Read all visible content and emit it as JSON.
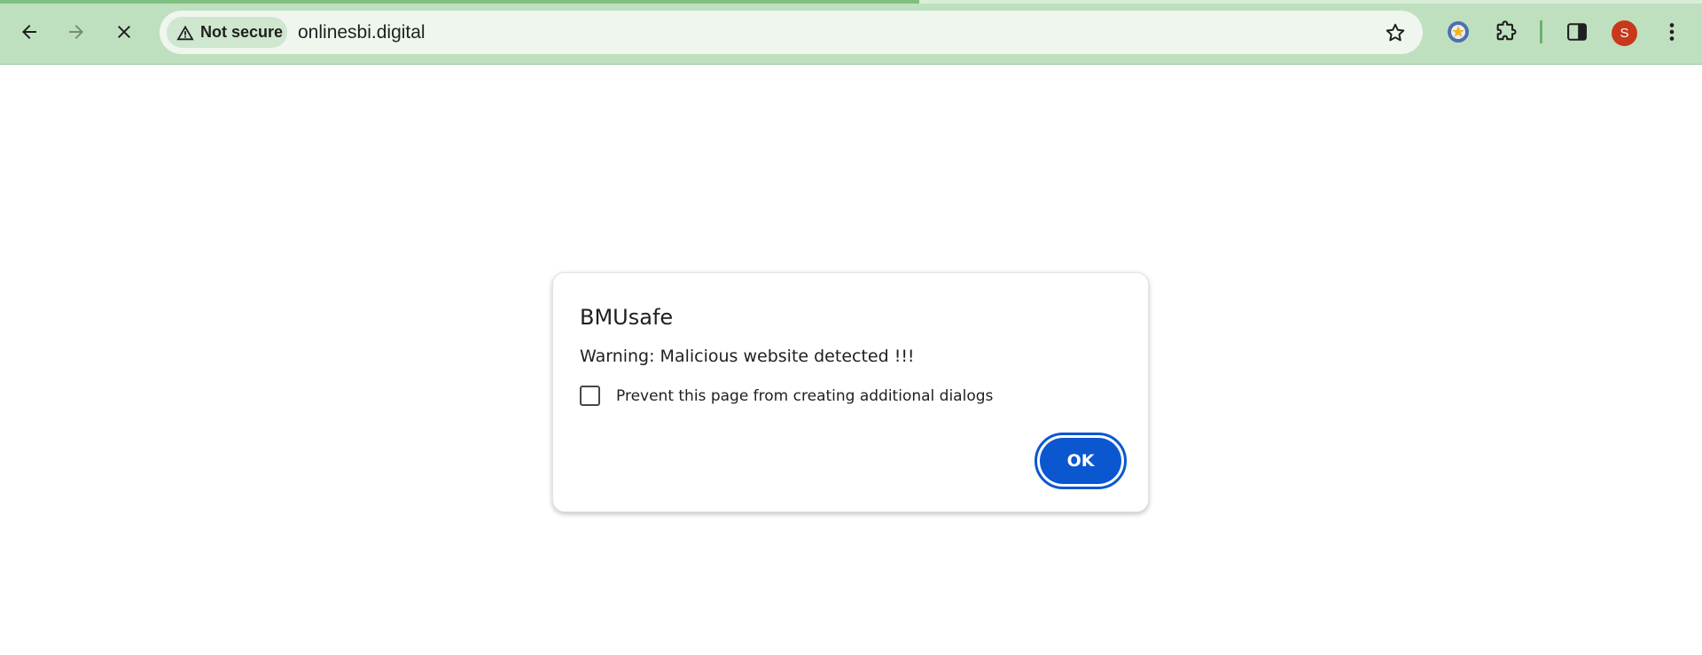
{
  "browser": {
    "page_load_progress": 0.54,
    "nav": {
      "back_icon": "arrow-left-icon",
      "forward_icon": "arrow-right-icon",
      "stop_icon": "close-icon"
    },
    "omnibox": {
      "security_label": "Not secure",
      "security_icon": "warning-triangle-icon",
      "url": "onlinesbi.digital",
      "bookmark_icon": "star-outline-icon"
    },
    "toolbar_icons": [
      "extension-badge-icon",
      "puzzle-icon",
      "side-panel-icon",
      "more-vert-icon"
    ],
    "profile": {
      "initial": "S",
      "color": "#c8381b"
    },
    "colors": {
      "toolbar_bg": "#bfe0bf",
      "omnibox_bg": "#eef6ee"
    }
  },
  "dialog": {
    "title": "BMUsafe",
    "message": "Warning: Malicious website detected !!!",
    "checkbox_label": "Prevent this page from creating additional dialogs",
    "checkbox_checked": false,
    "ok_label": "OK",
    "accent": "#0b57d0"
  }
}
